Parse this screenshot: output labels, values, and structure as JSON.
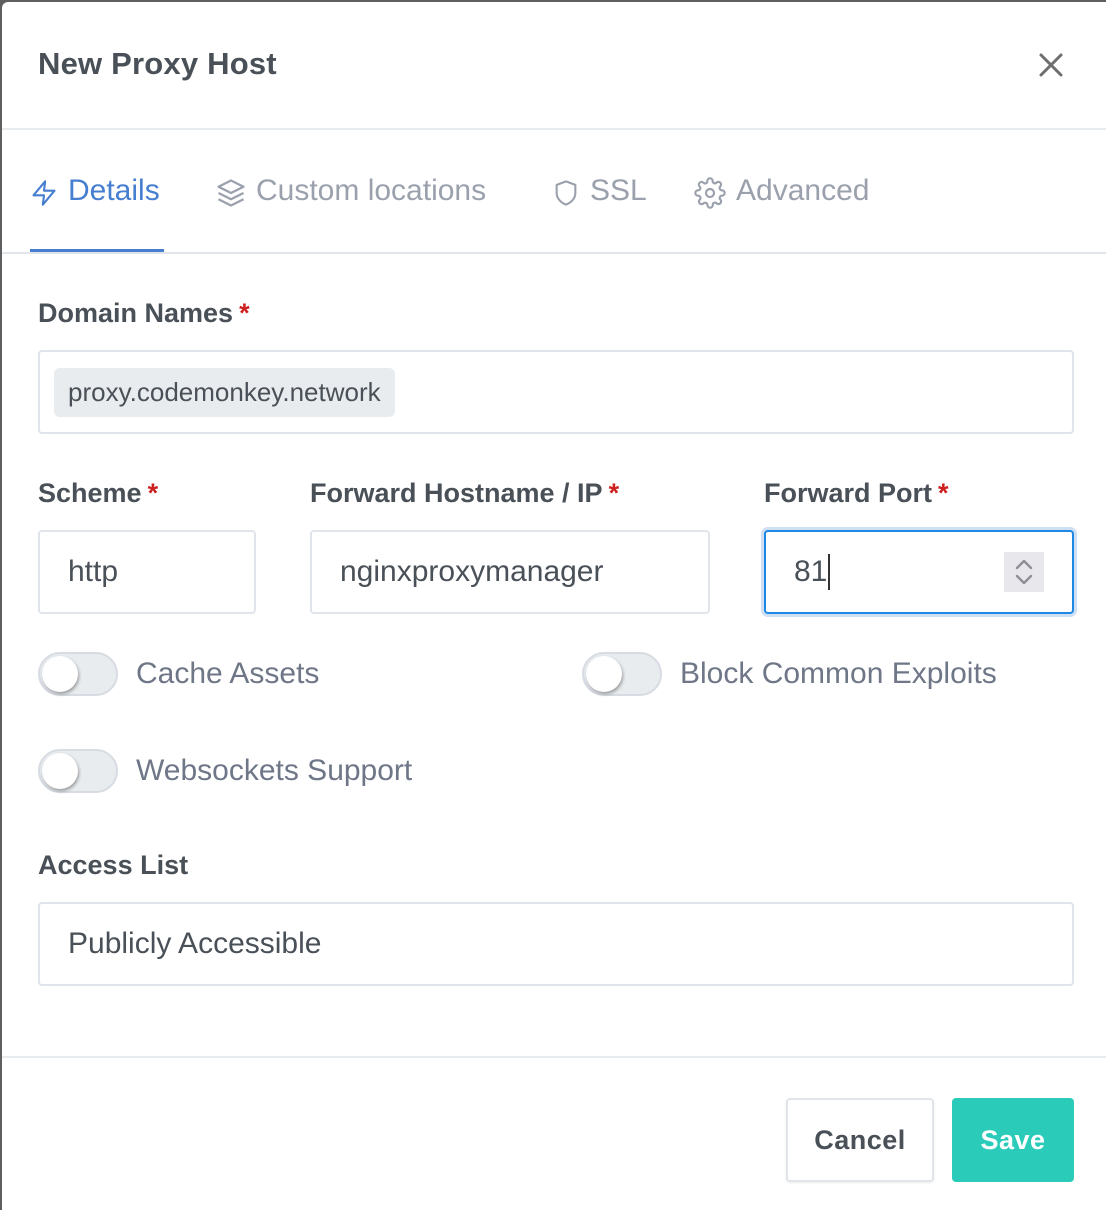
{
  "modal": {
    "title": "New Proxy Host"
  },
  "tabs": [
    {
      "label": "Details",
      "icon": "lightning-bolt-icon",
      "active": true
    },
    {
      "label": "Custom locations",
      "icon": "layers-icon",
      "active": false
    },
    {
      "label": "SSL",
      "icon": "shield-icon",
      "active": false
    },
    {
      "label": "Advanced",
      "icon": "gear-icon",
      "active": false
    }
  ],
  "form": {
    "domain_names": {
      "label": "Domain Names",
      "required_marker": "*",
      "tags": [
        "proxy.codemonkey.network"
      ]
    },
    "scheme": {
      "label": "Scheme",
      "required_marker": "*",
      "value": "http"
    },
    "forward_host": {
      "label": "Forward Hostname / IP",
      "required_marker": "*",
      "value": "nginxproxymanager"
    },
    "forward_port": {
      "label": "Forward Port",
      "required_marker": "*",
      "value": "81"
    },
    "toggles": [
      {
        "label": "Cache Assets",
        "checked": false
      },
      {
        "label": "Block Common Exploits",
        "checked": false
      },
      {
        "label": "Websockets Support",
        "checked": false
      }
    ],
    "access_list": {
      "label": "Access List",
      "value": "Publicly Accessible"
    }
  },
  "footer": {
    "cancel_label": "Cancel",
    "save_label": "Save"
  },
  "colors": {
    "accent": "#467fcf",
    "save": "#2bcbba",
    "required": "#cd201f",
    "focus_border": "#1e88e5"
  }
}
